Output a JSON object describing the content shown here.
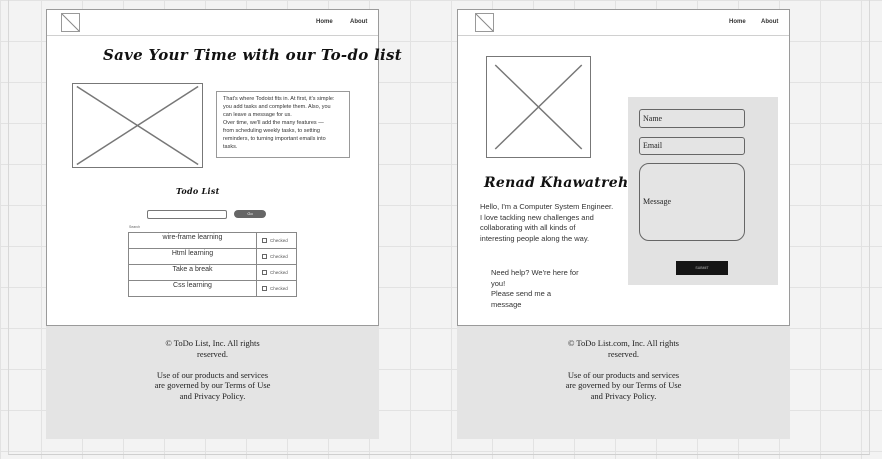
{
  "left_page": {
    "nav": {
      "home": "Home",
      "about": "About"
    },
    "title": "Save Your Time with our To-do list",
    "intro": [
      "That's where Todoist fits in. At first, it's simple:",
      "you add tasks and complete them. Also, you",
      "can leave a message for us.",
      "Over time, we'll add the many features —",
      "from scheduling weekly tasks, to setting",
      "reminders, to turning important emails into",
      "tasks."
    ],
    "todo_heading": "Todo List",
    "search_placeholder": "",
    "search_button": "Go",
    "table_caption": "Search",
    "tasks": [
      {
        "label": "wire-frame learning",
        "check": "Checked"
      },
      {
        "label": "Html learning",
        "check": "Checked"
      },
      {
        "label": "Take a break",
        "check": "Checked"
      },
      {
        "label": "Css learning",
        "check": "Checked"
      }
    ],
    "footer": {
      "line1": "© ToDo List, Inc. All rights",
      "line2": "reserved.",
      "line3": "Use of our products and services",
      "line4": "are governed by our Terms of Use",
      "line5": "and Privacy Policy."
    }
  },
  "right_page": {
    "nav": {
      "home": "Home",
      "about": "About"
    },
    "name": "Renad Khawatreh",
    "bio": [
      "Hello, I'm a Computer System Engineer.",
      "I love tackling new challenges and",
      "collaborating with all kinds of",
      "interesting people along the way."
    ],
    "help": [
      "Need help? We're here for",
      "you!",
      "Please send me a",
      "message"
    ],
    "form": {
      "name_label": "Name",
      "email_label": "Email",
      "message_label": "Message",
      "submit_label": "SUBMIT"
    },
    "footer": {
      "line1": "© ToDo List.com, Inc. All rights",
      "line2": "reserved.",
      "line3": "Use of our products and services",
      "line4": "are governed by our Terms of Use",
      "line5": "and Privacy Policy."
    }
  }
}
